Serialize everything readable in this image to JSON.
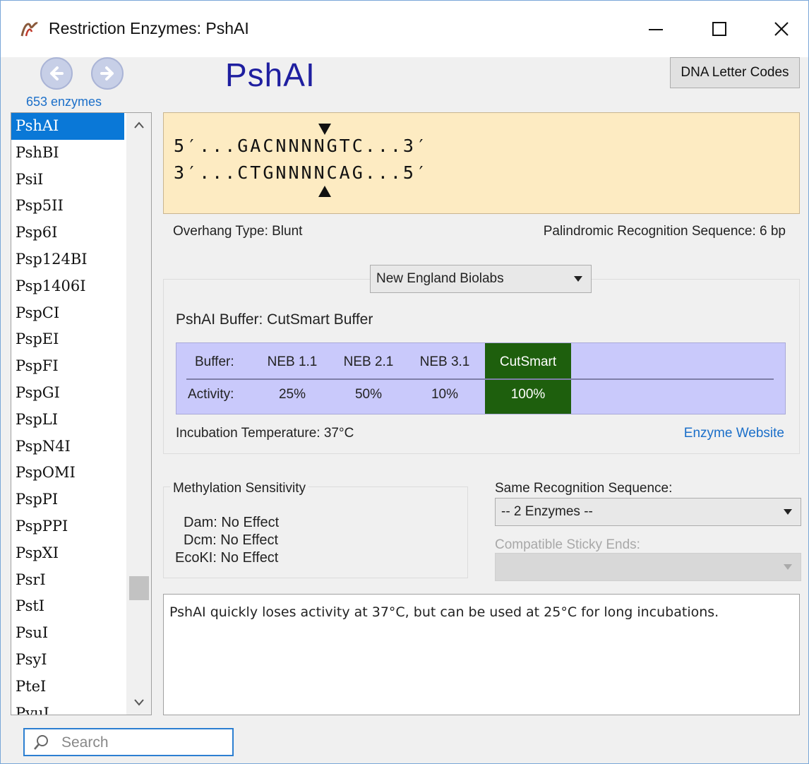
{
  "window": {
    "title": "Restriction Enzymes: PshAI",
    "controls": {
      "minimize": "—",
      "maximize": "☐",
      "close": "✕"
    }
  },
  "nav": {
    "back_icon": "back-arrow-icon",
    "forward_icon": "forward-arrow-icon",
    "enzyme_count": "653 enzymes"
  },
  "enzyme_title": "PshAI",
  "dna_letter_codes_label": "DNA Letter Codes",
  "enzyme_list": {
    "items": [
      "PshAI",
      "PshBI",
      "PsiI",
      "Psp5II",
      "Psp6I",
      "Psp124BI",
      "Psp1406I",
      "PspCI",
      "PspEI",
      "PspFI",
      "PspGI",
      "PspLI",
      "PspN4I",
      "PspOMI",
      "PspPI",
      "PspPPI",
      "PspXI",
      "PsrI",
      "PstI",
      "PsuI",
      "PsyI",
      "PteI",
      "PvuI"
    ],
    "selected": "PshAI"
  },
  "sequence": {
    "top": "5′...GACNNNNGTC...3′",
    "bottom": "3′...CTGNNNNCAG...5′"
  },
  "overhang": "Overhang Type:  Blunt",
  "palindrome": "Palindromic Recognition Sequence:  6 bp",
  "supplier": {
    "selected": "New England Biolabs"
  },
  "buffer": {
    "label": "PshAI Buffer:  CutSmart Buffer",
    "row_labels": [
      "Buffer:",
      "Activity:"
    ],
    "columns": [
      {
        "name": "NEB 1.1",
        "activity": "25%"
      },
      {
        "name": "NEB 2.1",
        "activity": "50%"
      },
      {
        "name": "NEB 3.1",
        "activity": "10%"
      },
      {
        "name": "CutSmart",
        "activity": "100%",
        "highlight": true
      }
    ],
    "highlight_color": "#1e5f0d"
  },
  "incubation": "Incubation Temperature:  37°C",
  "enzyme_website": "Enzyme Website",
  "methylation": {
    "title": "Methylation Sensitivity",
    "rows": [
      "Dam: No Effect",
      "Dcm: No Effect",
      "EcoKI: No Effect"
    ]
  },
  "same_recognition": {
    "label": "Same Recognition Sequence:",
    "selected": "-- 2 Enzymes --"
  },
  "compatible_sticky_ends": {
    "label": "Compatible Sticky Ends:"
  },
  "notes": "PshAI quickly loses activity at 37°C, but can be used at 25°C for long incubations.",
  "search": {
    "placeholder": "Search",
    "icon": "search-icon"
  }
}
